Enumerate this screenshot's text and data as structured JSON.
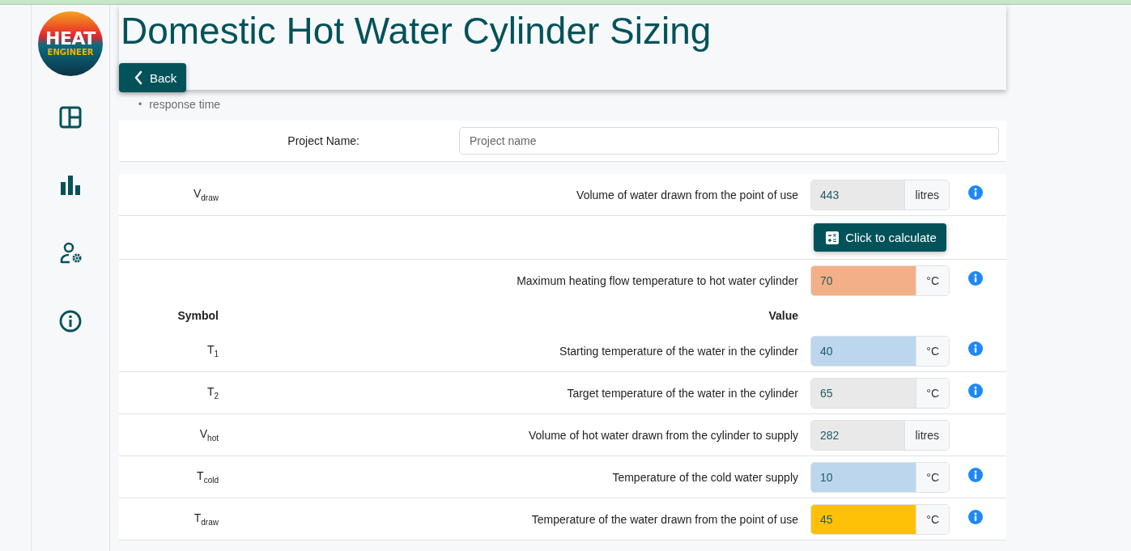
{
  "logo": {
    "lines": [
      "HEAT",
      "ENGINEER"
    ]
  },
  "header": {
    "title": "Domestic Hot Water Cylinder Sizing",
    "back_button": "Back"
  },
  "intro_list": [
    {
      "bullet": "•",
      "text": "response time"
    }
  ],
  "project": {
    "label": "Project Name:",
    "placeholder": "Project name"
  },
  "rows": [
    {
      "kind": "field",
      "symbol": "V$_{draw}$",
      "label": "Volume of water drawn from the point of use",
      "value": "443",
      "unit": "litres",
      "color": "#e9e9e9",
      "info": true
    },
    {
      "kind": "calculate",
      "button": "Click to calculate"
    },
    {
      "kind": "field",
      "symbol": "",
      "label": "Maximum heating flow temperature to hot water cylinder",
      "value": "70",
      "unit": "°C",
      "color": "#f3b087",
      "info": true
    },
    {
      "kind": "header",
      "symbol": "Symbol",
      "label": "Value"
    },
    {
      "kind": "field",
      "symbol": "T$_{1}$",
      "label": "Starting temperature of the water in the cylinder",
      "value": "40",
      "unit": "°C",
      "color": "#bcd7ed",
      "info": true
    },
    {
      "kind": "field",
      "symbol": "T$_{2}$",
      "label": "Target temperature of the water in the cylinder",
      "value": "65",
      "unit": "°C",
      "color": "#e9e9e9",
      "info": true
    },
    {
      "kind": "field",
      "symbol": "V$_{hot}$",
      "label": "Volume of hot water drawn from the cylinder to supply",
      "value": "282",
      "unit": "litres",
      "color": "#e9e9e9",
      "info": false
    },
    {
      "kind": "field",
      "symbol": "T$_{cold}$",
      "label": "Temperature of the cold water supply",
      "value": "10",
      "unit": "°C",
      "color": "#bcd7ed",
      "info": true
    },
    {
      "kind": "field",
      "symbol": "T$_{draw}$",
      "label": "Temperature of the water drawn from the point of use",
      "value": "45",
      "unit": "°C",
      "color": "#ffc107",
      "info": true
    }
  ]
}
